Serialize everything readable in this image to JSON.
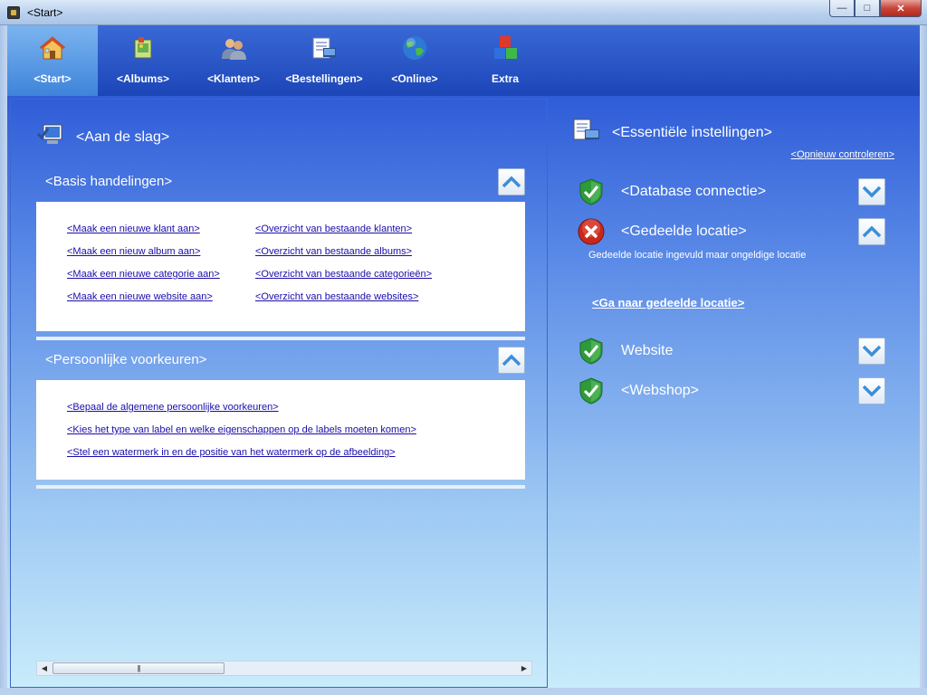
{
  "window": {
    "title": "<Start>",
    "minimize": "—",
    "maximize": "□",
    "close": "✕"
  },
  "toolbar": {
    "items": [
      {
        "label": "<Start>",
        "icon": "home-icon",
        "active": true
      },
      {
        "label": "<Albums>",
        "icon": "album-icon",
        "active": false
      },
      {
        "label": "<Klanten>",
        "icon": "customers-icon",
        "active": false
      },
      {
        "label": "<Bestellingen>",
        "icon": "orders-icon",
        "active": false
      },
      {
        "label": "<Online>",
        "icon": "globe-icon",
        "active": false
      },
      {
        "label": "Extra",
        "icon": "blocks-icon",
        "active": false
      }
    ]
  },
  "left": {
    "title": "<Aan de slag>",
    "basis": {
      "title": "<Basis handelingen>",
      "links_left": [
        "<Maak een nieuwe klant aan>",
        "<Maak een nieuw album aan>",
        "<Maak een nieuwe categorie aan>",
        "<Maak een nieuwe website aan>"
      ],
      "links_right": [
        "<Overzicht van bestaande klanten>",
        "<Overzicht van bestaande albums>",
        "<Overzicht van bestaande categorieën>",
        "<Overzicht van bestaande websites>"
      ]
    },
    "persoonlijk": {
      "title": "<Persoonlijke voorkeuren>",
      "links": [
        "<Bepaal de algemene persoonlijke voorkeuren>",
        "<Kies het type van label en welke eigenschappen op de labels moeten komen>",
        "<Stel een watermerk in en de positie van het watermerk op de afbeelding>"
      ]
    },
    "scrollbar": {
      "left_arrow": "◀",
      "right_arrow": "▶",
      "grip": "|||"
    }
  },
  "right": {
    "title": "<Essentiële instellingen>",
    "recheck": "<Opnieuw controleren>",
    "checks": [
      {
        "label": "<Database connectie>",
        "status": "ok",
        "expanded": false
      },
      {
        "label": "<Gedeelde locatie>",
        "status": "error",
        "expanded": true
      },
      {
        "label": "Website",
        "status": "ok",
        "expanded": false
      },
      {
        "label": "<Webshop>",
        "status": "ok",
        "expanded": false
      }
    ],
    "error_message": "Gedeelde locatie ingevuld maar ongeldige locatie",
    "goto_link": "<Ga naar gedeelde locatie>"
  },
  "colors": {
    "toolbar": "#1c46b8",
    "active_tab": "#5a9be4",
    "ok_green": "#2e9a3a",
    "error_red": "#c8281c",
    "link": "#1a0dab"
  }
}
